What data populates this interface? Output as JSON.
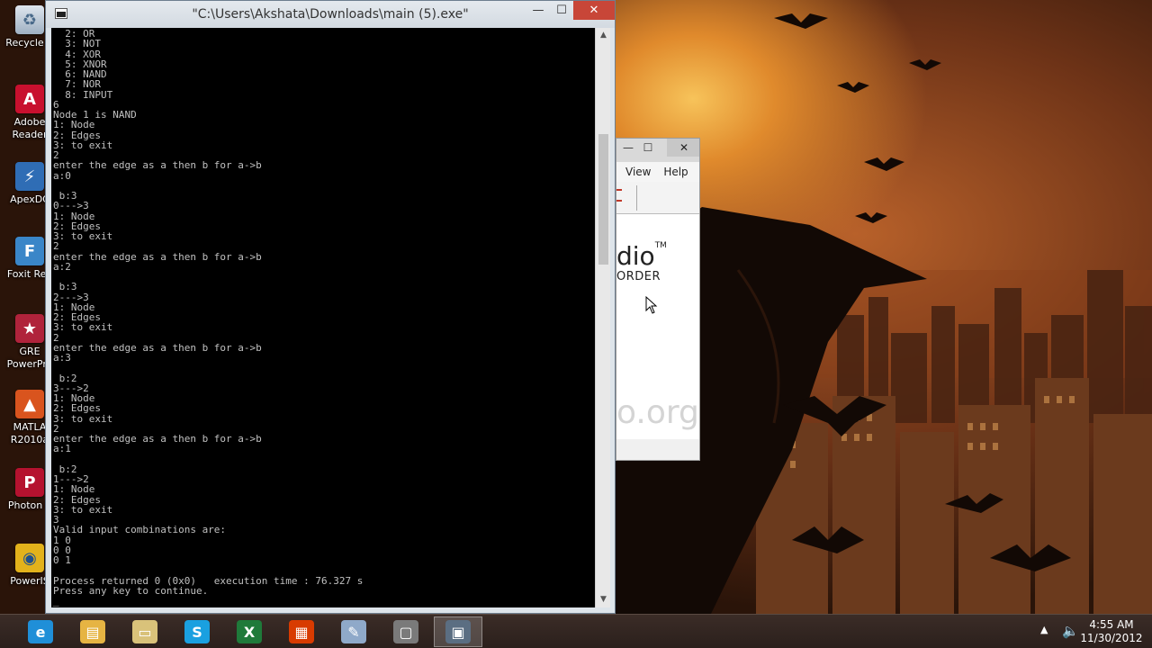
{
  "desktop": {
    "icons": [
      {
        "label": "Recycle B",
        "icon": "recycle-bin-icon"
      },
      {
        "label": "Adobe\nReader",
        "icon": "adobe-reader-icon"
      },
      {
        "label": "ApexDC",
        "icon": "apexdc-icon"
      },
      {
        "label": "Foxit Rea",
        "icon": "foxit-reader-icon"
      },
      {
        "label": "GRE\nPowerPre",
        "icon": "gre-powerprep-icon"
      },
      {
        "label": "MATLA\nR2010a",
        "icon": "matlab-icon"
      },
      {
        "label": "Photon F",
        "icon": "photon-icon"
      },
      {
        "label": "PowerIS",
        "icon": "poweriso-icon"
      }
    ]
  },
  "console": {
    "title": "\"C:\\Users\\Akshata\\Downloads\\main (5).exe\"",
    "min_symbol": "—",
    "max_symbol": "☐",
    "close_symbol": "✕",
    "output_lines": [
      "  2: OR",
      "  3: NOT",
      "  4: XOR",
      "  5: XNOR",
      "  6: NAND",
      "  7: NOR",
      "  8: INPUT",
      "6",
      "Node 1 is NAND",
      "1: Node",
      "2: Edges",
      "3: to exit",
      "2",
      "enter the edge as a then b for a->b",
      "a:0",
      "",
      " b:3",
      "0--->3",
      "1: Node",
      "2: Edges",
      "3: to exit",
      "2",
      "enter the edge as a then b for a->b",
      "a:2",
      "",
      " b:3",
      "2--->3",
      "1: Node",
      "2: Edges",
      "3: to exit",
      "2",
      "enter the edge as a then b for a->b",
      "a:3",
      "",
      " b:2",
      "3--->2",
      "1: Node",
      "2: Edges",
      "3: to exit",
      "2",
      "enter the edge as a then b for a->b",
      "a:1",
      "",
      " b:2",
      "1--->2",
      "1: Node",
      "2: Edges",
      "3: to exit",
      "3",
      "Valid input combinations are:",
      "1 0",
      "0 0",
      "0 1",
      "",
      "Process returned 0 (0x0)   execution time : 76.327 s",
      "Press any key to continue.",
      "_"
    ]
  },
  "background_window": {
    "min_symbol": "—",
    "max_symbol": "☐",
    "close_symbol": "✕",
    "menu": [
      "View",
      "Help"
    ],
    "brand_text": "dio",
    "brand_tm": "TM",
    "brand_sub": "ORDER",
    "url_fragment": "o.org"
  },
  "taskbar": {
    "items": [
      {
        "name": "internet-explorer",
        "glyph": "e",
        "color": "#1f8fd8"
      },
      {
        "name": "file-explorer",
        "glyph": "▤",
        "color": "#e6b443"
      },
      {
        "name": "folder",
        "glyph": "▭",
        "color": "#d9c27a"
      },
      {
        "name": "skype",
        "glyph": "S",
        "color": "#1aa0e0"
      },
      {
        "name": "excel",
        "glyph": "X",
        "color": "#1f7a3a"
      },
      {
        "name": "office",
        "glyph": "▦",
        "color": "#d83b01"
      },
      {
        "name": "paint",
        "glyph": "✎",
        "color": "#8fa9c9"
      },
      {
        "name": "screen-recorder",
        "glyph": "▢",
        "color": "#7a7a7a"
      },
      {
        "name": "console-app",
        "glyph": "▣",
        "color": "#5b6e82"
      }
    ],
    "tray_arrow": "▲",
    "volume_symbol": "🔈",
    "time": "4:55 AM",
    "date": "11/30/2012"
  }
}
